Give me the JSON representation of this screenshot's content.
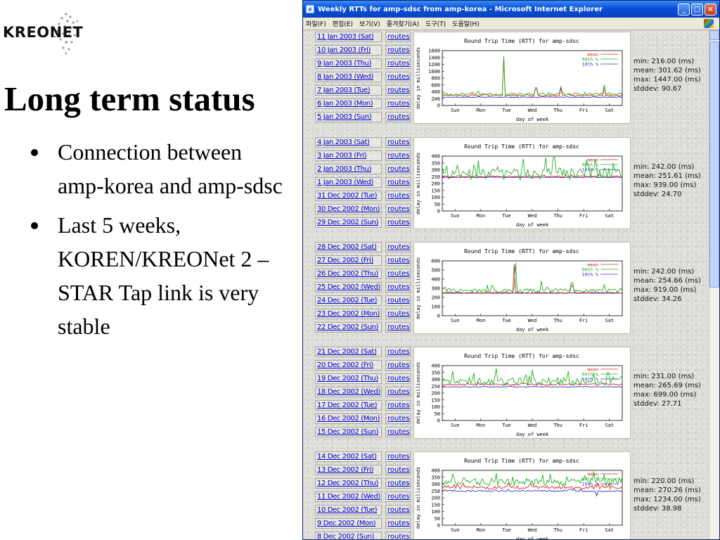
{
  "slide": {
    "logo_text": "KREONET",
    "title": "Long term status",
    "bullets": [
      "Connection between amp-korea and amp-sdsc",
      "Last 5 weeks, KOREN/KREONet 2 – STAR Tap link is very stable"
    ]
  },
  "window": {
    "title": "Weekly RTTs for amp-sdsc from amp-korea - Microsoft Internet Explorer",
    "menu": [
      "파일(F)",
      "편집(E)",
      "보기(V)",
      "즐겨찾기(A)",
      "도구(T)",
      "도움말(H)"
    ],
    "buttons": {
      "minimize": "_",
      "maximize": "□",
      "close": "×"
    }
  },
  "colors": {
    "mean": "#dd2020",
    "p90": "#20b020",
    "p10": "#3030cc",
    "title_bar": "#0a4fd6",
    "link": "#0000cc"
  },
  "routes_label": "routes",
  "graph_common": {
    "title": "Round Trip Time (RTT) for amp-sdsc",
    "ylabel": "delay in milliseconds",
    "xlabel": "day of week",
    "days": [
      "Sun",
      "Mon",
      "Tue",
      "Wed",
      "Thu",
      "Fri",
      "Sat"
    ],
    "legend": [
      "mean",
      "90th %",
      "10th %"
    ]
  },
  "weeks": [
    {
      "dates": [
        "11 Jan 2003 (Sat)",
        "10 Jan 2003 (Fri)",
        "9 Jan 2003 (Thu)",
        "8 Jan 2003 (Wed)",
        "7 Jan 2003 (Tue)",
        "6 Jan 2003 (Mon)",
        "5 Jan 2003 (Sun)"
      ],
      "stats": {
        "min": "min: 216.00 (ms)",
        "mean": "mean: 301.62 (ms)",
        "max": "max: 1447.00 (ms)",
        "stddev": "stddev: 90.67"
      },
      "yticks": [
        "1600",
        "1400",
        "1200",
        "1000",
        "800",
        "600",
        "400",
        "200",
        "0"
      ],
      "ymax": 1600,
      "chart_data": {
        "type": "line",
        "ylim": [
          0,
          1600
        ],
        "series": [
          {
            "name": "mean",
            "base": 290,
            "amp": 40,
            "spikes": [
              [
                0.34,
                1400
              ],
              [
                0.52,
                480
              ],
              [
                0.66,
                520
              ],
              [
                0.9,
                560
              ]
            ]
          },
          {
            "name": "90th %",
            "base": 330,
            "amp": 70,
            "spikes": [
              [
                0.34,
                1440
              ],
              [
                0.52,
                520
              ],
              [
                0.66,
                560
              ],
              [
                0.9,
                600
              ]
            ]
          },
          {
            "name": "10th %",
            "base": 240,
            "amp": 20,
            "spikes": []
          }
        ]
      }
    },
    {
      "dates": [
        "4 Jan 2003 (Sat)",
        "3 Jan 2003 (Fri)",
        "2 Jan 2003 (Thu)",
        "1 Jan 2003 (Wed)",
        "31 Dec 2002 (Tue)",
        "30 Dec 2002 (Mon)",
        "29 Dec 2002 (Sun)"
      ],
      "stats": {
        "min": "min: 242.00 (ms)",
        "mean": "mean: 251.61 (ms)",
        "max": "max: 939.00 (ms)",
        "stddev": "stddev: 24.70"
      },
      "yticks": [
        "400",
        "350",
        "300",
        "250",
        "200",
        "150",
        "100",
        "50",
        "0"
      ],
      "ymax": 400,
      "chart_data": {
        "type": "line",
        "ylim": [
          0,
          400
        ],
        "series": [
          {
            "name": "mean",
            "base": 252,
            "amp": 10,
            "spikes": []
          },
          {
            "name": "90th %",
            "base": 270,
            "amp": 90,
            "spikes": [
              [
                0.2,
                370
              ],
              [
                0.45,
                380
              ],
              [
                0.62,
                390
              ],
              [
                0.8,
                370
              ],
              [
                0.95,
                350
              ]
            ]
          },
          {
            "name": "10th %",
            "base": 245,
            "amp": 4,
            "spikes": []
          }
        ]
      }
    },
    {
      "dates": [
        "28 Dec 2002 (Sat)",
        "27 Dec 2002 (Fri)",
        "26 Dec 2002 (Thu)",
        "25 Dec 2002 (Wed)",
        "24 Dec 2002 (Tue)",
        "23 Dec 2002 (Mon)",
        "22 Dec 2002 (Sun)"
      ],
      "stats": {
        "min": "min: 242.00 (ms)",
        "mean": "mean: 254.66 (ms)",
        "max": "max: 919.00 (ms)",
        "stddev": "stddev: 34.26"
      },
      "yticks": [
        "600",
        "500",
        "400",
        "300",
        "200",
        "100",
        "0"
      ],
      "ymax": 600,
      "chart_data": {
        "type": "line",
        "ylim": [
          0,
          600
        ],
        "series": [
          {
            "name": "mean",
            "base": 252,
            "amp": 12,
            "spikes": [
              [
                0.4,
                560
              ],
              [
                0.72,
                330
              ]
            ]
          },
          {
            "name": "90th %",
            "base": 275,
            "amp": 40,
            "spikes": [
              [
                0.41,
                580
              ],
              [
                0.55,
                380
              ],
              [
                0.72,
                360
              ],
              [
                0.9,
                340
              ]
            ]
          },
          {
            "name": "10th %",
            "base": 246,
            "amp": 3,
            "spikes": []
          }
        ]
      }
    },
    {
      "dates": [
        "21 Dec 2002 (Sat)",
        "20 Dec 2002 (Fri)",
        "19 Dec 2002 (Thu)",
        "18 Dec 2002 (Wed)",
        "17 Dec 2002 (Tue)",
        "16 Dec 2002 (Mon)",
        "15 Dec 2002 (Sun)"
      ],
      "stats": {
        "min": "min: 231.00 (ms)",
        "mean": "mean: 265.69 (ms)",
        "max": "max: 699.00 (ms)",
        "stddev": "stddev: 27.71"
      },
      "yticks": [
        "400",
        "350",
        "300",
        "250",
        "200",
        "150",
        "100",
        "50",
        "0"
      ],
      "ymax": 400,
      "chart_data": {
        "type": "line",
        "ylim": [
          0,
          400
        ],
        "series": [
          {
            "name": "mean",
            "base": 262,
            "amp": 12,
            "spikes": []
          },
          {
            "name": "90th %",
            "base": 285,
            "amp": 60,
            "spikes": [
              [
                0.06,
                360
              ],
              [
                0.3,
                380
              ],
              [
                0.5,
                370
              ],
              [
                0.7,
                360
              ],
              [
                0.92,
                350
              ]
            ]
          },
          {
            "name": "10th %",
            "base": 245,
            "amp": 5,
            "spikes": []
          }
        ]
      }
    },
    {
      "dates": [
        "14 Dec 2002 (Sat)",
        "13 Dec 2002 (Fri)",
        "12 Dec 2002 (Thu)",
        "11 Dec 2002 (Wed)",
        "10 Dec 2002 (Tue)",
        "9 Dec 2002 (Mon)",
        "8 Dec 2002 (Sun)"
      ],
      "stats": {
        "min": "min: 220.00 (ms)",
        "mean": "mean: 270.26 (ms)",
        "max": "max: 1234.00 (ms)",
        "stddev": "stddev: 38.98"
      },
      "yticks": [
        "400",
        "350",
        "300",
        "250",
        "200",
        "150",
        "100",
        "50",
        "0"
      ],
      "ymax": 400,
      "chart_data": {
        "type": "line",
        "ylim": [
          0,
          400
        ],
        "series": [
          {
            "name": "mean",
            "base": 275,
            "amp": 25,
            "spikes": []
          },
          {
            "name": "90th %",
            "base": 315,
            "amp": 60,
            "spikes": [
              [
                0.3,
                380
              ],
              [
                0.6,
                375
              ],
              [
                0.9,
                370
              ]
            ]
          },
          {
            "name": "10th %",
            "base": 250,
            "amp": 10,
            "spikes": [
              [
                0.86,
                215
              ]
            ]
          }
        ]
      }
    }
  ]
}
